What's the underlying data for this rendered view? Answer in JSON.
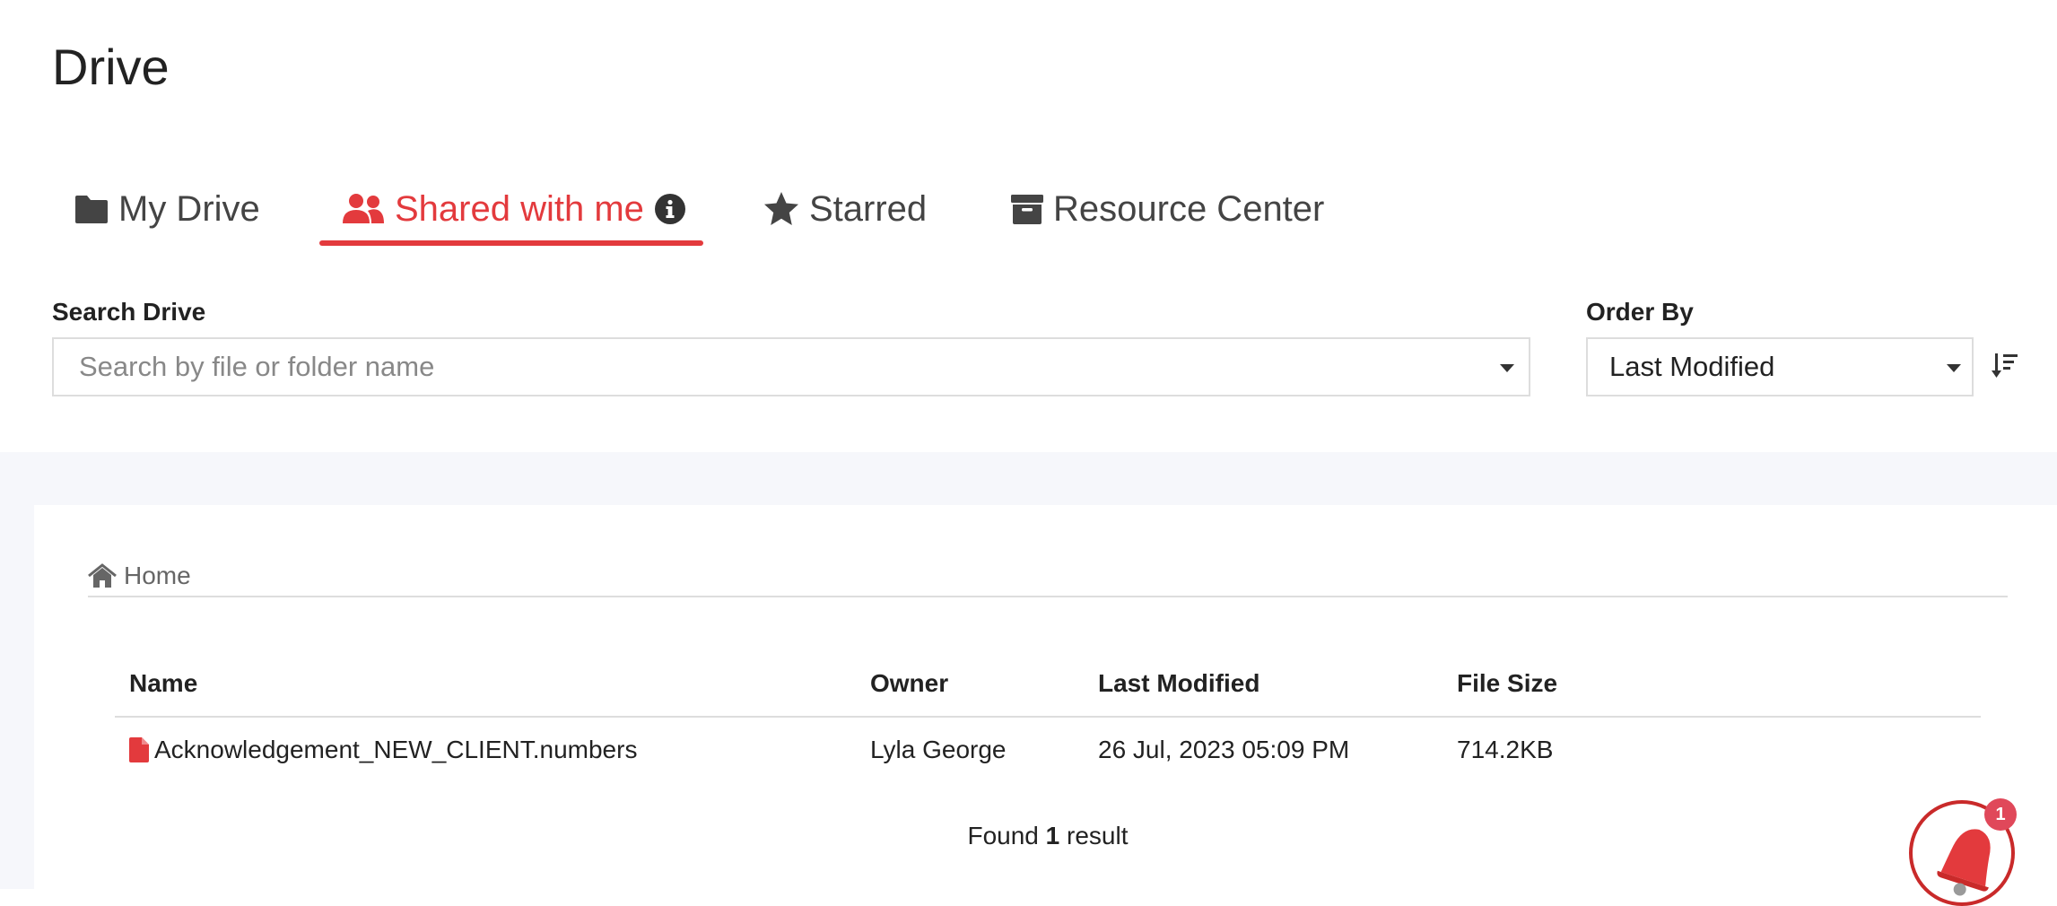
{
  "page": {
    "title": "Drive"
  },
  "tabs": [
    {
      "label": "My Drive",
      "icon": "folder-icon",
      "active": false
    },
    {
      "label": "Shared with me",
      "icon": "users-icon",
      "active": true
    },
    {
      "label": "Starred",
      "icon": "star-icon",
      "active": false
    },
    {
      "label": "Resource Center",
      "icon": "archive-icon",
      "active": false
    }
  ],
  "search": {
    "label": "Search Drive",
    "placeholder": "Search by file or folder name",
    "value": ""
  },
  "order": {
    "label": "Order By",
    "selected": "Last Modified"
  },
  "breadcrumb": {
    "home_label": "Home"
  },
  "table": {
    "columns": [
      "Name",
      "Owner",
      "Last Modified",
      "File Size"
    ],
    "rows": [
      {
        "name": "Acknowledgement_NEW_CLIENT.numbers",
        "owner": "Lyla George",
        "modified": "26 Jul, 2023 05:09 PM",
        "size": "714.2KB",
        "icon": "file-icon"
      }
    ]
  },
  "results": {
    "prefix": "Found",
    "count": "1",
    "suffix": "result"
  },
  "notifications": {
    "badge_count": "1"
  },
  "colors": {
    "accent": "#e33a3d",
    "file_icon": "#e33a3d",
    "band": "#f6f7fb"
  }
}
